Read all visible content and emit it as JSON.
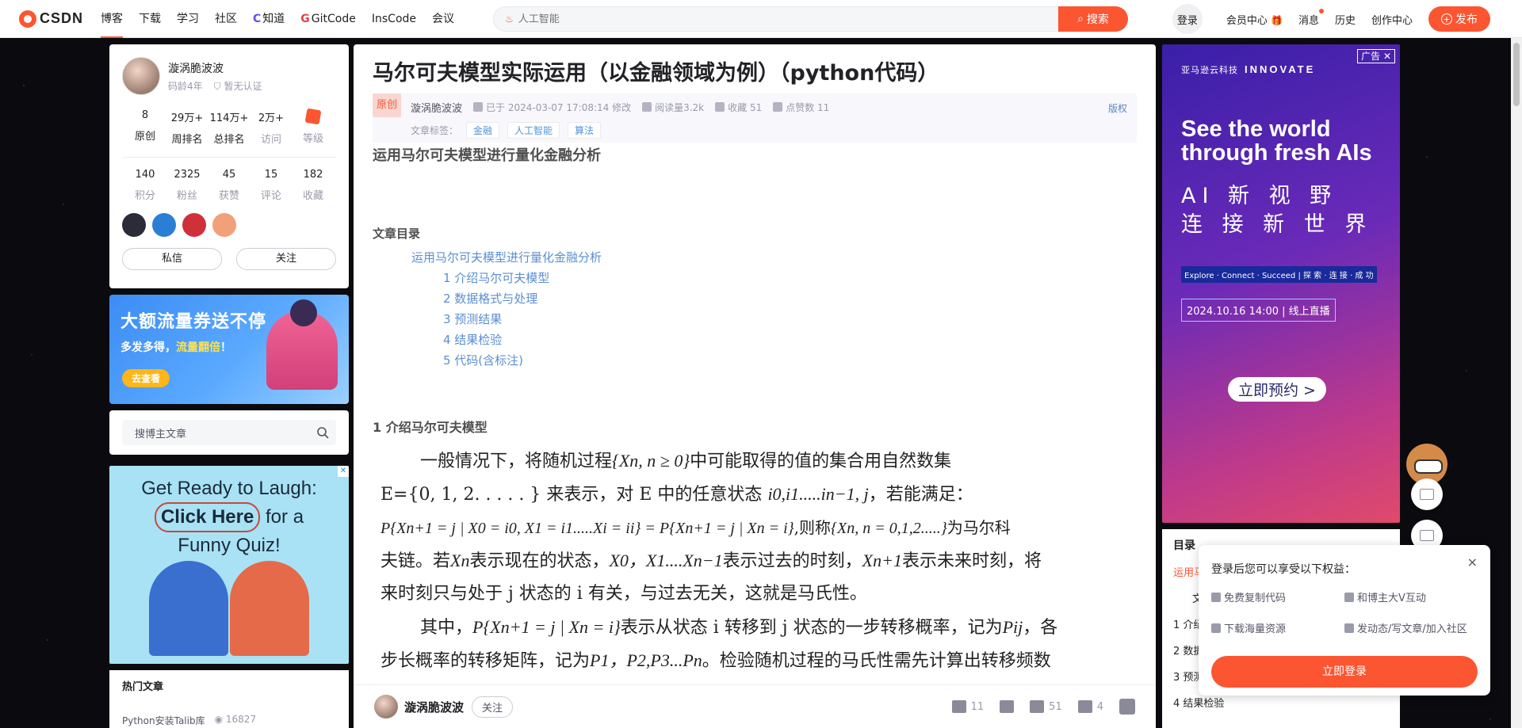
{
  "topbar": {
    "logo_text": "CSDN",
    "nav": [
      "博客",
      "下载",
      "学习",
      "社区",
      "知道",
      "GitCode",
      "InsCode",
      "会议"
    ],
    "search_placeholder": "人工智能",
    "search_button": "搜索",
    "login": "登录",
    "member_center": "会员中心",
    "messages": "消息",
    "history": "历史",
    "creator_center": "创作中心",
    "publish": "发布"
  },
  "profile": {
    "name": "漩涡脆波波",
    "age": "码龄4年",
    "cert": "暂无认证",
    "stats_row1": [
      {
        "value": "8",
        "label": "原创"
      },
      {
        "value": "29万+",
        "label": "周排名"
      },
      {
        "value": "114万+",
        "label": "总排名"
      },
      {
        "value": "2万+",
        "label": "访问"
      },
      {
        "value": "",
        "label": "等级"
      }
    ],
    "stats_row2": [
      {
        "value": "140",
        "label": "积分"
      },
      {
        "value": "2325",
        "label": "粉丝"
      },
      {
        "value": "45",
        "label": "获赞"
      },
      {
        "value": "15",
        "label": "评论"
      },
      {
        "value": "182",
        "label": "收藏"
      }
    ],
    "badge_colors": [
      "#2b2b3a",
      "#2a7fd4",
      "#d0303a",
      "#f2a07a"
    ],
    "message_btn": "私信",
    "follow_btn": "关注"
  },
  "promo": {
    "title": "大额流量券送不停",
    "subtitle_a": "多发多得，",
    "subtitle_b": "流量翻倍",
    "subtitle_c": "！",
    "button": "去查看"
  },
  "blog_search": {
    "placeholder": "搜博主文章"
  },
  "quiz_ad": {
    "line1": "Get Ready to Laugh:",
    "click": "Click Here",
    "line2_rest": " for a",
    "line3": "Funny Quiz!"
  },
  "hot": {
    "title": "热门文章",
    "items": [
      {
        "title": "Python安装Talib库",
        "views": "16827"
      }
    ]
  },
  "article": {
    "title": "马尔可夫模型实际运用（以金融领域为例）（python代码）",
    "orig": "原创",
    "author": "漩涡脆波波",
    "date": "已于 2024-03-07 17:08:14 修改",
    "reads": "阅读量3.2k",
    "favs": "收藏 51",
    "likes": "点赞数 11",
    "copyright": "版权",
    "tags_label": "文章标签：",
    "tags": [
      "金融",
      "人工智能",
      "算法"
    ],
    "h_main": "运用马尔可夫模型进行量化金融分析",
    "toc_title": "文章目录",
    "toc": [
      "运用马尔可夫模型进行量化金融分析",
      "1 介绍马尔可夫模型",
      "2 数据格式与处理",
      "3 预测结果",
      "4 结果检验",
      "5 代码(含标注)"
    ],
    "h1": "1 介绍马尔可夫模型",
    "p1_l1a": "一般情况下，将随机过程",
    "p1_l1m": "{Xn, n ≥ 0}",
    "p1_l1b": "中可能取得的值的集合用自然数集",
    "p1_l2a": "E={0, 1, 2. . . . . } 来表示，对 E 中的任意状态",
    "p1_l2m": "i0,i1.....in−1, j",
    "p1_l2b": "，若能满足：",
    "p1_l3m": "P{Xn+1 = j | X0 = i0, X1 = i1.....Xi = ii} = P{Xn+1 = j | Xn = i}",
    "p1_l3a": ",则称",
    "p1_l3m2": "{Xn, n = 0,1,2.....}",
    "p1_l3b": "为马尔科",
    "p1_l4a": "夫链。若",
    "p1_l4m1": "Xn",
    "p1_l4b": "表示现在的状态，",
    "p1_l4m2": "X0，X1....Xn−1",
    "p1_l4c": "表示过去的时刻，",
    "p1_l4m3": "Xn+1",
    "p1_l4d": "表示未来时刻，将",
    "p1_l5": "来时刻只与处于 j 状态的 i 有关，与过去无关，这就是马氏性。",
    "p2_l1a": "其中，",
    "p2_l1m": "P{Xn+1 = j | Xn = i}",
    "p2_l1b": "表示从状态 i 转移到 j 状态的一步转移概率，记为",
    "p2_l1m2": "Pij",
    "p2_l1c": "，各",
    "p2_l2a": "步长概率的转移矩阵，记为",
    "p2_l2m": "P1，P2,P3...Pn",
    "p2_l2b": "。检验随机过程的马氏性需先计算出转移频数"
  },
  "bottom_bar": {
    "author": "漩涡脆波波",
    "follow": "关注",
    "likes": "11",
    "stars": "51",
    "comments": "4"
  },
  "aws_ad": {
    "ad_label": "广告",
    "brand_cn": "亚马逊云科技",
    "brand_en": "INNOVATE",
    "headline": "See the world through fresh AIs",
    "cn1": "AI 新 视 野",
    "cn2": "连 接 新 世 界",
    "strip": "Explore · Connect · Succeed | 探 索 · 连 接 · 成 功",
    "date": "2024.10.16 14:00 | 线上直播",
    "button": "立即预约 >"
  },
  "toc_side": {
    "title": "目录",
    "items": [
      "运用马",
      "文",
      "1 介绍",
      "2 数据",
      "3 预测",
      "4 结果检验"
    ]
  },
  "login_pop": {
    "title": "登录后您可以享受以下权益：",
    "benefits": [
      "免费复制代码",
      "和博主大V互动",
      "下载海量资源",
      "发动态/写文章/加入社区"
    ],
    "button": "立即登录",
    "close": "×"
  }
}
